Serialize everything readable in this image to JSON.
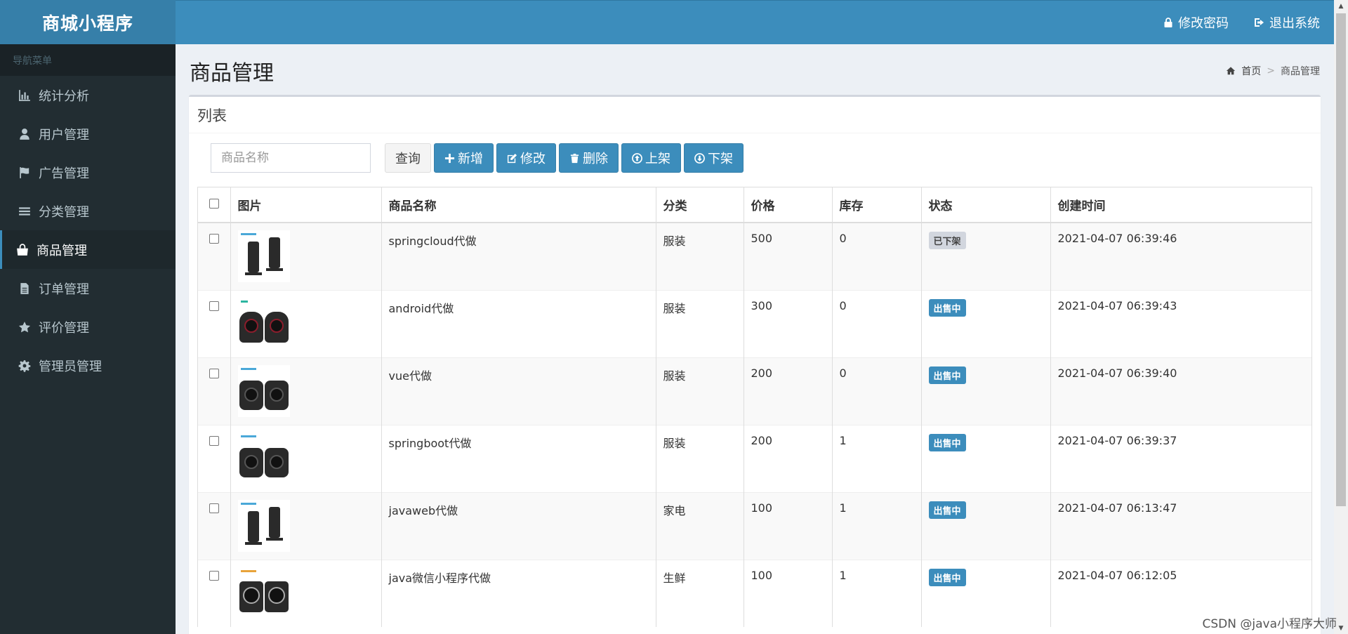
{
  "app": {
    "logo": "商城小程序"
  },
  "sidebar": {
    "header": "导航菜单",
    "items": [
      {
        "label": "统计分析",
        "icon": "bar-chart-icon"
      },
      {
        "label": "用户管理",
        "icon": "user-icon"
      },
      {
        "label": "广告管理",
        "icon": "flag-icon"
      },
      {
        "label": "分类管理",
        "icon": "list-icon"
      },
      {
        "label": "商品管理",
        "icon": "shopping-bag-icon"
      },
      {
        "label": "订单管理",
        "icon": "file-icon"
      },
      {
        "label": "评价管理",
        "icon": "star-icon"
      },
      {
        "label": "管理员管理",
        "icon": "gear-icon"
      }
    ]
  },
  "header": {
    "change_password": "修改密码",
    "logout": "退出系统"
  },
  "page": {
    "title": "商品管理",
    "breadcrumb_home": "首页",
    "breadcrumb_sep": ">",
    "breadcrumb_current": "商品管理"
  },
  "box": {
    "title": "列表"
  },
  "toolbar": {
    "search_placeholder": "商品名称",
    "query": "查询",
    "add": "新增",
    "edit": "修改",
    "delete": "删除",
    "on_shelf": "上架",
    "off_shelf": "下架"
  },
  "table": {
    "columns": [
      "图片",
      "商品名称",
      "分类",
      "价格",
      "库存",
      "状态",
      "创建时间"
    ],
    "rows": [
      {
        "name": "springcloud代做",
        "category": "服装",
        "price": "500",
        "stock": "0",
        "status": "已下架",
        "created": "2021-04-07 06:39:46"
      },
      {
        "name": "android代做",
        "category": "服装",
        "price": "300",
        "stock": "0",
        "status": "出售中",
        "created": "2021-04-07 06:39:43"
      },
      {
        "name": "vue代做",
        "category": "服装",
        "price": "200",
        "stock": "0",
        "status": "出售中",
        "created": "2021-04-07 06:39:40"
      },
      {
        "name": "springboot代做",
        "category": "服装",
        "price": "200",
        "stock": "1",
        "status": "出售中",
        "created": "2021-04-07 06:39:37"
      },
      {
        "name": "javaweb代做",
        "category": "家电",
        "price": "100",
        "stock": "1",
        "status": "出售中",
        "created": "2021-04-07 06:13:47"
      },
      {
        "name": "java微信小程序代做",
        "category": "生鲜",
        "price": "100",
        "stock": "1",
        "status": "出售中",
        "created": "2021-04-07 06:12:05"
      }
    ]
  },
  "colors": {
    "primary": "#3c8dbc",
    "sidebar": "#222d32",
    "logo_bg": "#367fa9"
  },
  "watermark": "CSDN @java小程序大师"
}
